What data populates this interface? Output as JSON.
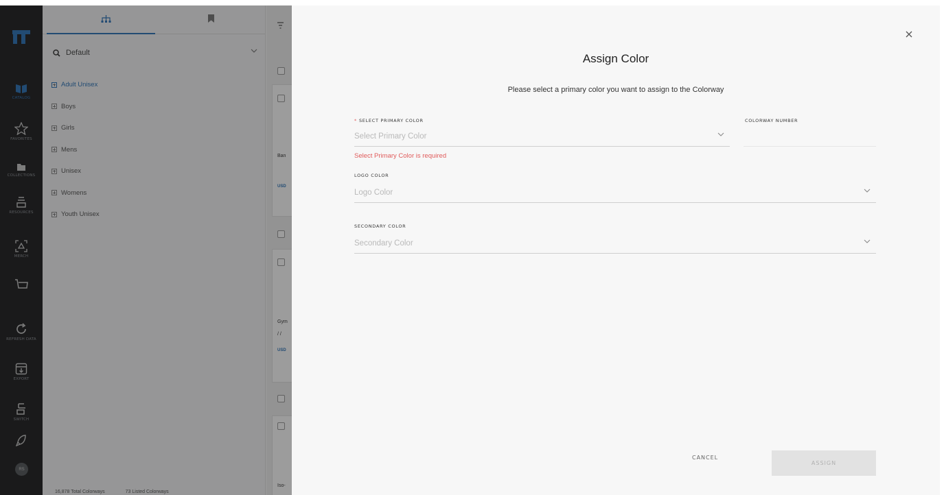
{
  "nav": {
    "items": [
      {
        "label": "Catalog",
        "icon": "catalog-icon",
        "active": true
      },
      {
        "label": "Favorites",
        "icon": "star-icon"
      },
      {
        "label": "Collections",
        "icon": "folder-icon"
      },
      {
        "label": "Resources",
        "icon": "resources-icon"
      },
      {
        "label": "Merch",
        "icon": "merch-icon"
      },
      {
        "label": "",
        "icon": "cart-icon"
      },
      {
        "label": "Refresh Data",
        "icon": "refresh-icon"
      },
      {
        "label": "Export",
        "icon": "export-icon"
      },
      {
        "label": "Switch",
        "icon": "switch-icon"
      },
      {
        "label": "",
        "icon": "rocket-icon"
      }
    ],
    "avatar_initials": "RS",
    "accent_color": "#2d74b8"
  },
  "tree": {
    "search_value": "Default",
    "items": [
      "Adult Unisex",
      "Boys",
      "Girls",
      "Mens",
      "Unisex",
      "Womens",
      "Youth Unisex"
    ],
    "selected_index": 0,
    "footer": {
      "total": "16,878 Total Colorways",
      "listed": "73 Listed Colorways"
    }
  },
  "list": {
    "item1_name": "Ban",
    "item1_price": "USD",
    "item2_name": "Gym",
    "item2_sub": "/ /",
    "item2_price": "USD",
    "item3_name": "Iso-"
  },
  "modal": {
    "title": "Assign Color",
    "subtitle": "Please select a primary color you want to assign to the Colorway",
    "primary_label": "Select Primary Color",
    "primary_required_mark": "*",
    "primary_placeholder": "Select Primary Color",
    "primary_error": "Select Primary Color is required",
    "colorway_label": "Colorway Number",
    "colorway_value": "",
    "logo_label": "Logo Color",
    "logo_placeholder": "Logo Color",
    "secondary_label": "Secondary Color",
    "secondary_placeholder": "Secondary Color",
    "cancel": "Cancel",
    "assign": "Assign",
    "error_color": "#e05a5a"
  }
}
